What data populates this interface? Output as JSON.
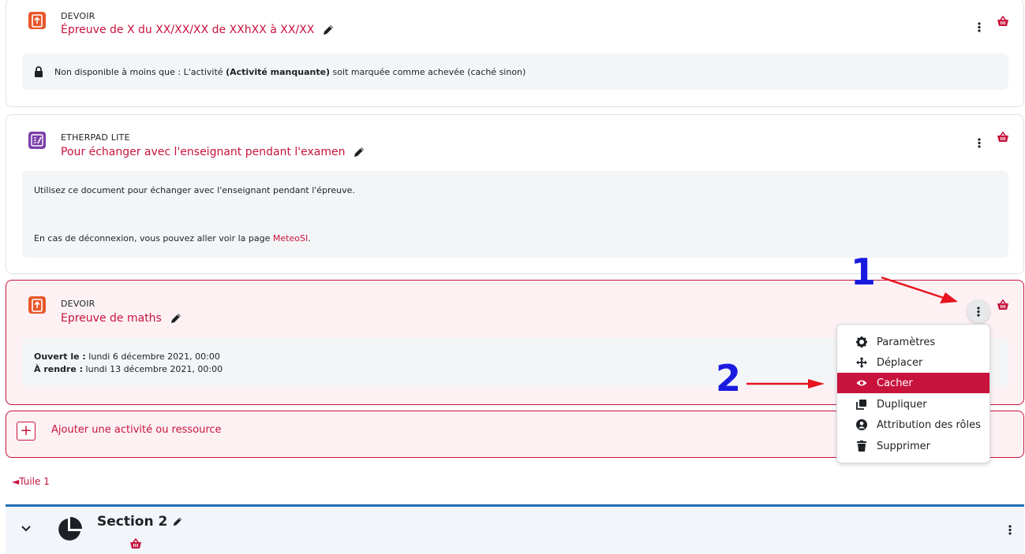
{
  "colors": {
    "accent": "#c8133d",
    "devoir_icon": "#e8572a",
    "etherpad_icon": "#7b3fa9",
    "section_border": "#1f6fb5",
    "annotation": "#1b1be0",
    "arrow": "#e8141f"
  },
  "activities": [
    {
      "type": "DEVOIR",
      "title": "Épreuve de X du XX/XX/XX de XXhXX à XX/XX",
      "restriction_prefix": "Non disponible à moins que : L'activité ",
      "restriction_bold": "(Activité manquante)",
      "restriction_suffix": " soit marquée comme achevée (caché sinon)"
    },
    {
      "type": "ETHERPAD LITE",
      "title": "Pour échanger avec l'enseignant pendant l'examen",
      "desc_line1": "Utilisez ce document pour échanger avec l'enseignant pendant l'épreuve.",
      "desc_line2_prefix": "En cas de déconnexion, vous pouvez aller voir la page ",
      "desc_line2_link": "MeteoSI",
      "desc_line2_suffix": "."
    },
    {
      "type": "DEVOIR",
      "title": "Epreuve de maths",
      "opened_label": "Ouvert le :",
      "opened_value": " lundi 6 décembre 2021, 00:00",
      "due_label": "À rendre :",
      "due_value": " lundi 13 décembre 2021, 00:00"
    }
  ],
  "add_activity_label": "Ajouter une activité ou ressource",
  "tile_link": "◄Tuile 1",
  "section": {
    "title": "Section 2"
  },
  "context_menu": {
    "items": [
      {
        "label": "Paramètres",
        "icon": "gear-icon"
      },
      {
        "label": "Déplacer",
        "icon": "move-icon"
      },
      {
        "label": "Cacher",
        "icon": "eye-icon"
      },
      {
        "label": "Dupliquer",
        "icon": "copy-icon"
      },
      {
        "label": "Attribution des rôles",
        "icon": "user-circle-icon"
      },
      {
        "label": "Supprimer",
        "icon": "trash-icon"
      }
    ],
    "selected": "Cacher"
  },
  "annotations": {
    "step1": "1",
    "step2": "2"
  }
}
